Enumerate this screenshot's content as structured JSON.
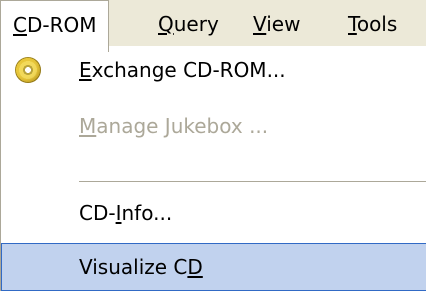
{
  "menubar": {
    "items": [
      {
        "text": "CD-ROM",
        "mnemonic": "C",
        "active": true
      },
      {
        "text": "Query",
        "mnemonic": "Q"
      },
      {
        "text": "View",
        "mnemonic": "V"
      },
      {
        "text": "Tools",
        "mnemonic": "T"
      }
    ]
  },
  "dropdown": {
    "items": [
      {
        "before": "",
        "mnemonic": "E",
        "after": "xchange CD-ROM...",
        "icon": "cd-disc-icon",
        "enabled": true
      },
      {
        "before": "",
        "mnemonic": "M",
        "after": "anage Jukebox ...",
        "enabled": false
      },
      {
        "before": "CD-",
        "mnemonic": "I",
        "after": "nfo...",
        "enabled": true
      },
      {
        "before": "Visualize C",
        "mnemonic": "D",
        "after": "",
        "enabled": true,
        "highlighted": true
      }
    ]
  },
  "colors": {
    "menubar_bg": "#ece9d8",
    "menu_bg": "#ffffff",
    "highlight_bg": "#c1d2ee",
    "highlight_border": "#316ac5",
    "disabled_text": "#aca899"
  }
}
